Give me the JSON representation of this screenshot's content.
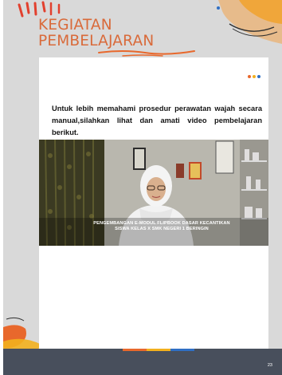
{
  "title": {
    "line1": "KEGIATAN",
    "line2": "PEMBELAJARAN"
  },
  "instruction": "Untuk lebih memahami prosedur perawatan wajah secara manual,silahkan lihat dan amati video pembelajaran berikut.",
  "video": {
    "caption_line1": "PENGEMBANGAN E-MODUL FLIPBOOK DASAR KECANTIKAN",
    "caption_line2": "SISWA KELAS X SMK NEGERI 1 BERINGIN"
  },
  "page_number": "23",
  "colors": {
    "accent_orange": "#e8682c",
    "accent_yellow": "#f2b01e",
    "accent_blue": "#2f6fc4",
    "title": "#d96a3a",
    "page_background": "#d9d9d9",
    "bottom_band": "#484f5c"
  }
}
